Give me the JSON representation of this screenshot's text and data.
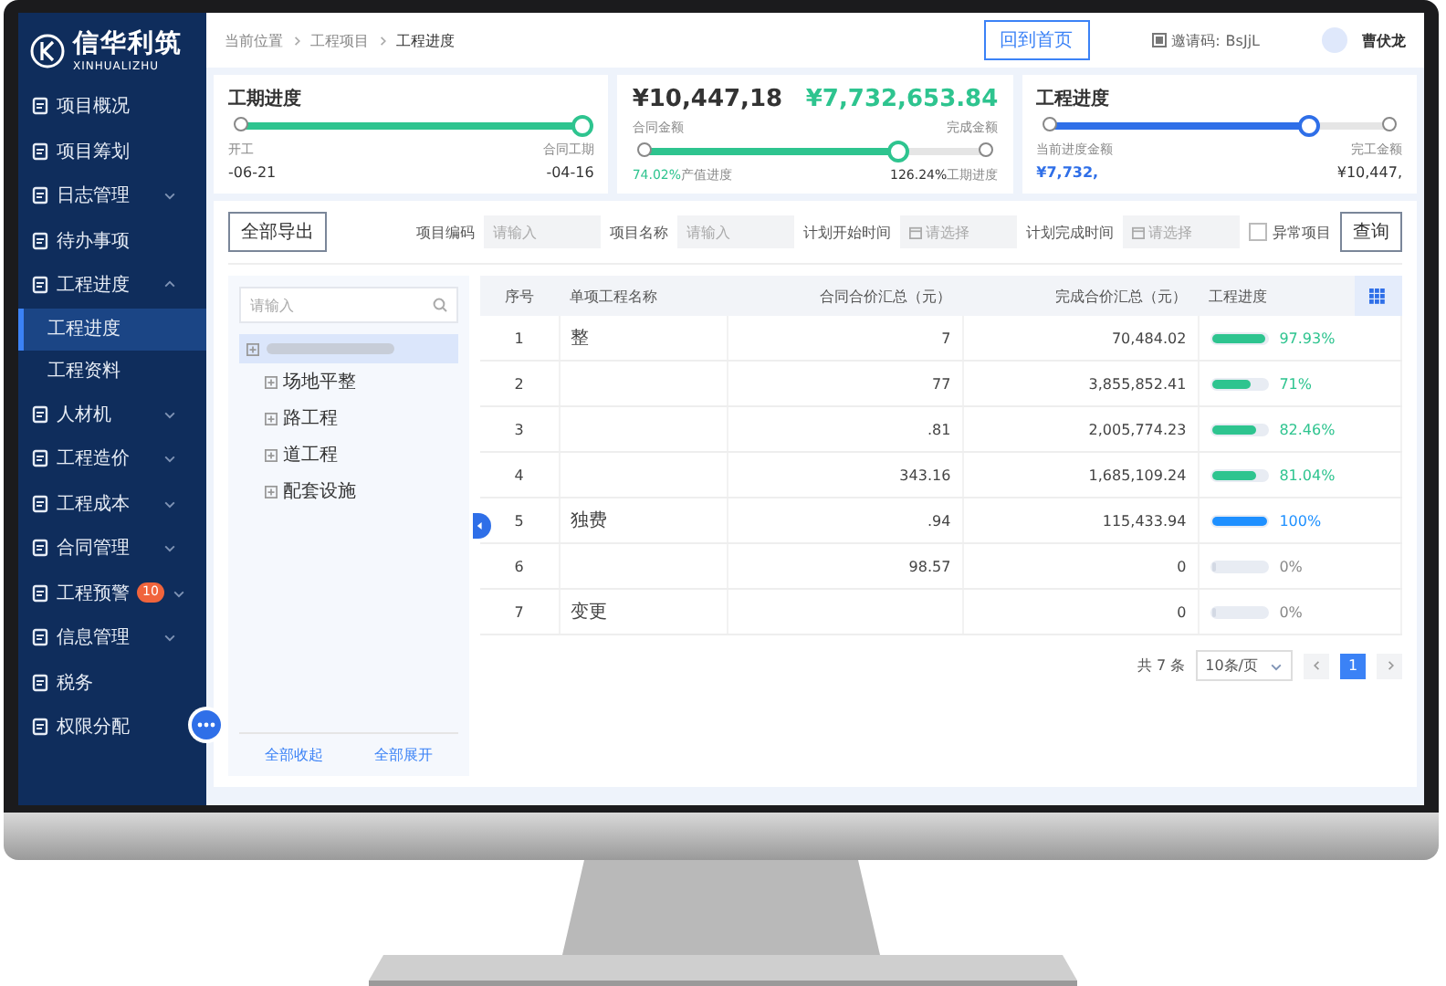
{
  "logo": {
    "name": "信华利筑",
    "pinyin": "XINHUALIZHU"
  },
  "sidebar": {
    "items": [
      {
        "label": "项目概况",
        "kind": "link"
      },
      {
        "label": "项目筹划",
        "kind": "link"
      },
      {
        "label": "日志管理",
        "kind": "group",
        "expanded": false
      },
      {
        "label": "待办事项",
        "kind": "link"
      },
      {
        "label": "工程进度",
        "kind": "group",
        "expanded": true,
        "children": [
          {
            "label": "工程进度",
            "selected": true
          },
          {
            "label": "工程资料",
            "selected": false
          }
        ]
      },
      {
        "label": "人材机",
        "kind": "group",
        "expanded": false
      },
      {
        "label": "工程造价",
        "kind": "group",
        "expanded": false
      },
      {
        "label": "工程成本",
        "kind": "group",
        "expanded": false
      },
      {
        "label": "合同管理",
        "kind": "group",
        "expanded": false
      },
      {
        "label": "工程预警",
        "kind": "group",
        "expanded": false,
        "badge": "10"
      },
      {
        "label": "信息管理",
        "kind": "group",
        "expanded": false
      },
      {
        "label": "税务",
        "kind": "link"
      },
      {
        "label": "权限分配",
        "kind": "link"
      }
    ]
  },
  "breadcrumb": [
    "当前位置",
    "工程项目",
    "工程进度"
  ],
  "header": {
    "home_button": "回到首页",
    "invite_label": "邀请码:",
    "invite_code": "BsJjL",
    "user_name": "曹伏龙"
  },
  "schedule_card": {
    "title": "工期进度",
    "level": 1,
    "start_label": "开工",
    "start_date": "-06-21",
    "end_label": "合同工期",
    "end_date": "-04-16"
  },
  "amount_card": {
    "contract_amount": "¥10,447,18",
    "contract_label": "合同金额",
    "completed_amount": "¥7,732,653.84",
    "completed_label": "完成金额",
    "level": 0.74,
    "output_progress": "74.02%",
    "output_label": "产值进度",
    "schedule_progress": "126.24%",
    "schedule_label": "工期进度"
  },
  "progress_card": {
    "title": "工程进度",
    "level": 0.76,
    "current_label": "当前进度金额",
    "current_amount": "¥7,732,",
    "final_label": "完工金额",
    "final_amount": "¥10,447,"
  },
  "toolbar": {
    "export_button": "全部导出",
    "fields": [
      {
        "label": "项目编码",
        "placeholder": "请输入",
        "kind": "text"
      },
      {
        "label": "项目名称",
        "placeholder": "请输入",
        "kind": "text"
      },
      {
        "label": "计划开始时间",
        "placeholder": "请选择",
        "kind": "date"
      },
      {
        "label": "计划完成时间",
        "placeholder": "请选择",
        "kind": "date"
      }
    ],
    "checkbox": {
      "label": "异常项目",
      "checked": false
    },
    "query_button": "查询"
  },
  "tree": {
    "search_placeholder": "请输入",
    "root": {
      "selected": true,
      "children": [
        {
          "label": "场地平整",
          "kind": "branch"
        },
        {
          "label": "路工程",
          "kind": "branch"
        },
        {
          "label": "道工程",
          "kind": "branch"
        },
        {
          "label": "配套设施",
          "kind": "branch"
        }
      ]
    },
    "footer_buttons": [
      "全部收起",
      "全部展开"
    ]
  },
  "table": {
    "columns": [
      "序号",
      "单项工程名称",
      "合同合价汇总（元）",
      "完成合价汇总（元）",
      "工程进度"
    ],
    "rows": [
      {
        "index": "1",
        "name": "整",
        "contract_total": "7",
        "completed_total": "70,484.02",
        "progress": "97.93%",
        "level": 0.98,
        "color": "#2ec48f"
      },
      {
        "index": "2",
        "contract_total": "77",
        "completed_total": "3,855,852.41",
        "progress": "71%",
        "level": 0.71,
        "color": "#2ec48f"
      },
      {
        "index": "3",
        "contract_total": ".81",
        "completed_total": "2,005,774.23",
        "progress": "82.46%",
        "level": 0.82,
        "color": "#2ec48f"
      },
      {
        "index": "4",
        "contract_total": "343.16",
        "completed_total": "1,685,109.24",
        "progress": "81.04%",
        "level": 0.81,
        "color": "#2ec48f"
      },
      {
        "index": "5",
        "name": "独费",
        "contract_total": ".94",
        "completed_total": "115,433.94",
        "progress": "100%",
        "level": 1,
        "color": "#1e90ff"
      },
      {
        "index": "6",
        "contract_total": "98.57",
        "completed_total": "0",
        "progress": "0%",
        "level": 0
      },
      {
        "index": "7",
        "name": "变更",
        "completed_total": "0",
        "progress": "0%",
        "level": 0
      }
    ]
  },
  "pagination": {
    "total": "共 7 条",
    "page_size": "10条/页",
    "pages": [
      {
        "label": "1",
        "selected": true
      }
    ]
  }
}
